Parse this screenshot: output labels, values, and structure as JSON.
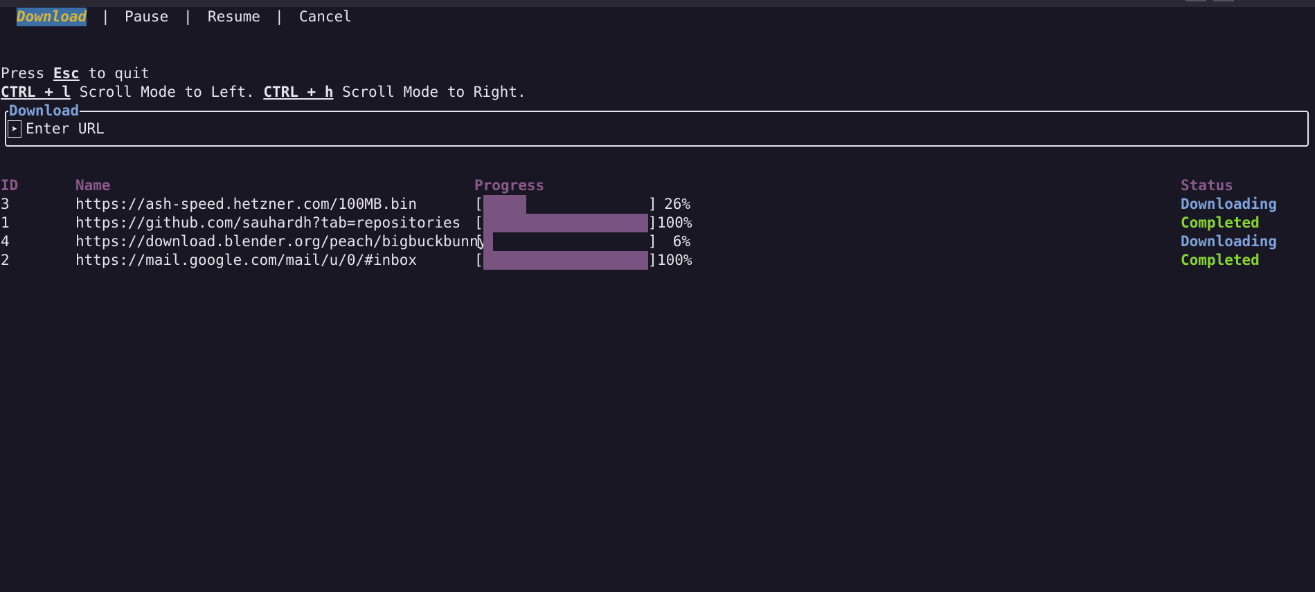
{
  "menu": {
    "tabs": [
      {
        "label": "Download",
        "active": true
      },
      {
        "label": "Pause",
        "active": false
      },
      {
        "label": "Resume",
        "active": false
      },
      {
        "label": "Cancel",
        "active": false
      }
    ],
    "separator": "|"
  },
  "help": {
    "line1_prefix": "Press ",
    "line1_key": "Esc",
    "line1_suffix": " to quit",
    "line2_key1": "CTRL + l",
    "line2_text1": " Scroll Mode to Left. ",
    "line2_key2": "CTRL + h",
    "line2_text2": " Scroll Mode to Right."
  },
  "input": {
    "title": "Download",
    "prompt_icon": "➤",
    "placeholder": "Enter URL"
  },
  "table": {
    "headers": {
      "id": "ID",
      "name": "Name",
      "progress": "Progress",
      "status": "Status"
    },
    "rows": [
      {
        "id": "3",
        "name": "https://ash-speed.hetzner.com/100MB.bin",
        "progress": 0.26,
        "percent": "26%",
        "status": "Downloading"
      },
      {
        "id": "1",
        "name": "https://github.com/sauhardh?tab=repositories",
        "progress": 1.0,
        "percent": "100%",
        "status": "Completed"
      },
      {
        "id": "4",
        "name": "https://download.blender.org/peach/bigbuckbunny",
        "progress": 0.06,
        "percent": "6%",
        "status": "Downloading"
      },
      {
        "id": "2",
        "name": "https://mail.google.com/mail/u/0/#inbox",
        "progress": 1.0,
        "percent": "100%",
        "status": "Completed"
      }
    ]
  },
  "colors": {
    "background": "#1a1724",
    "accent_blue": "#7ea4dc",
    "accent_green": "#86d82e",
    "header_purple": "#8a5a8c",
    "bar_fill": "#7a5480",
    "active_tab_bg": "#3c6fa6",
    "active_tab_fg": "#d8b63a"
  }
}
